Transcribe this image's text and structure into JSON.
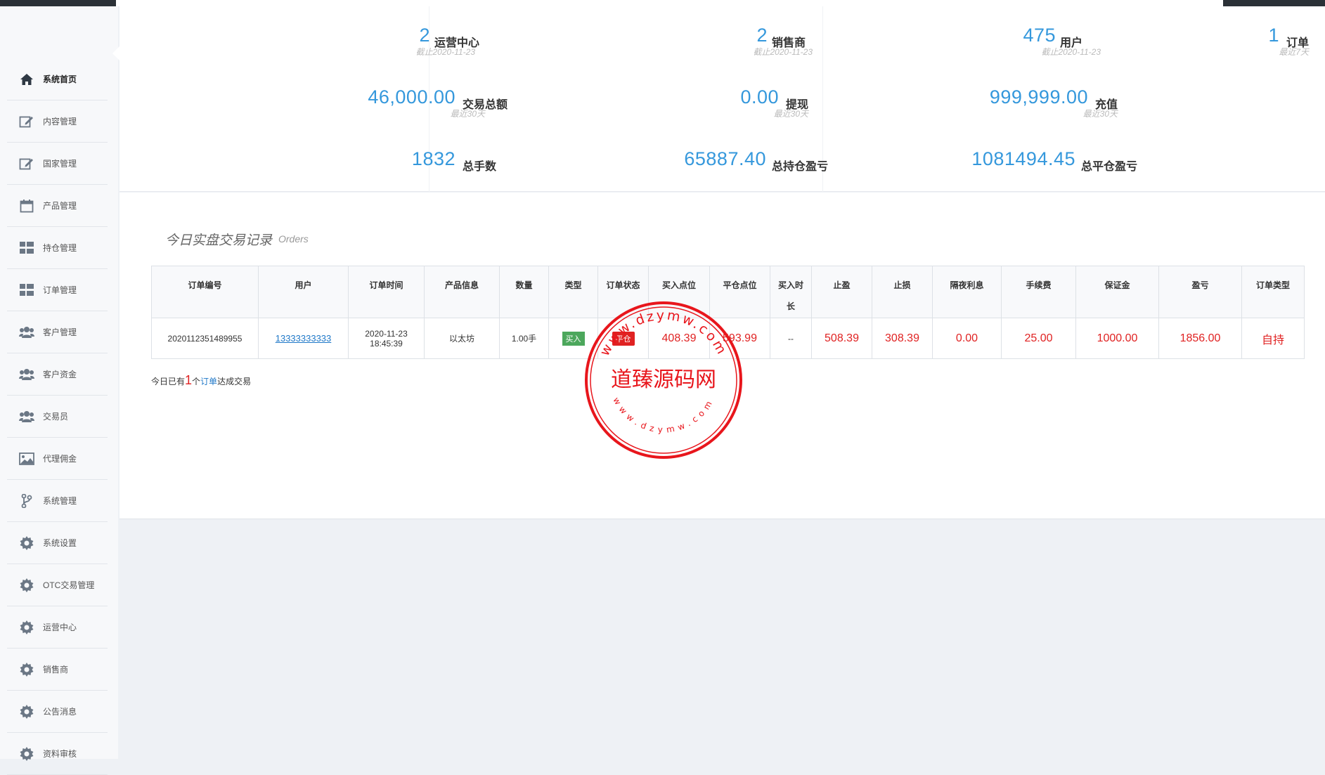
{
  "sidebar": {
    "items": [
      {
        "label": "系统首页",
        "icon": "home-icon",
        "active": true
      },
      {
        "label": "内容管理",
        "icon": "edit-icon"
      },
      {
        "label": "国家管理",
        "icon": "edit-icon"
      },
      {
        "label": "产品管理",
        "icon": "calendar-icon"
      },
      {
        "label": "持仓管理",
        "icon": "grid-icon"
      },
      {
        "label": "订单管理",
        "icon": "grid-icon"
      },
      {
        "label": "客户管理",
        "icon": "users-icon"
      },
      {
        "label": "客户资金",
        "icon": "users-icon"
      },
      {
        "label": "交易员",
        "icon": "users-icon"
      },
      {
        "label": "代理佣金",
        "icon": "image-icon"
      },
      {
        "label": "系统管理",
        "icon": "branch-icon"
      },
      {
        "label": "系统设置",
        "icon": "gear-icon"
      },
      {
        "label": "OTC交易管理",
        "icon": "gear-icon"
      },
      {
        "label": "运营中心",
        "icon": "gear-icon"
      },
      {
        "label": "销售商",
        "icon": "gear-icon"
      },
      {
        "label": "公告消息",
        "icon": "gear-icon"
      },
      {
        "label": "资料审核",
        "icon": "gear-icon"
      }
    ]
  },
  "stats": {
    "row1": [
      {
        "num": "2",
        "name": "运营中心",
        "sub": "截止2020-11-23"
      },
      {
        "num": "2",
        "name": "销售商",
        "sub": "截止2020-11-23"
      },
      {
        "num": "475",
        "name": "用户",
        "sub": "截止2020-11-23"
      },
      {
        "num": "1",
        "name": "订单",
        "sub": "最近7天"
      }
    ],
    "row2": [
      {
        "num": "46,000.00",
        "name": "交易总额",
        "sub": "最近30天"
      },
      {
        "num": "0.00",
        "name": "提现",
        "sub": "最近30天"
      },
      {
        "num": "999,999.00",
        "name": "充值",
        "sub": "最近30天"
      }
    ],
    "row3": [
      {
        "num": "1832",
        "name": "总手数"
      },
      {
        "num": "65887.40",
        "name": "总持仓盈亏"
      },
      {
        "num": "1081494.45",
        "name": "总平仓盈亏"
      }
    ]
  },
  "orders": {
    "title": "今日实盘交易记录",
    "subtitle": "Orders",
    "headers": [
      "订单编号",
      "用户",
      "订单时间",
      "产品信息",
      "数量",
      "类型",
      "订单状态",
      "买入点位",
      "平仓点位",
      "买入时长",
      "止盈",
      "止损",
      "隔夜利息",
      "手续费",
      "保证金",
      "盈亏",
      "订单类型"
    ],
    "row": {
      "id": "2020112351489955",
      "user": "13333333333",
      "date": "2020-11-23",
      "time": "18:45:39",
      "product": "以太坊",
      "qty": "1.00手",
      "type": "买入",
      "status": "平仓",
      "buy_price": "408.39",
      "close_price": "593.99",
      "duration": "--",
      "take_profit": "508.39",
      "stop_loss": "308.39",
      "overnight": "0.00",
      "fee": "25.00",
      "margin": "1000.00",
      "pnl": "1856.00",
      "order_type": "自持"
    },
    "summary_prefix": "今日已有",
    "summary_count": "1",
    "summary_mid": "个",
    "summary_link": "订单",
    "summary_suffix": "达成交易"
  },
  "watermark": {
    "center_text": "道臻源码网",
    "top_text": "www.dzymw.com",
    "bottom_text": "www.dzymw.com",
    "color": "#e8161c"
  }
}
